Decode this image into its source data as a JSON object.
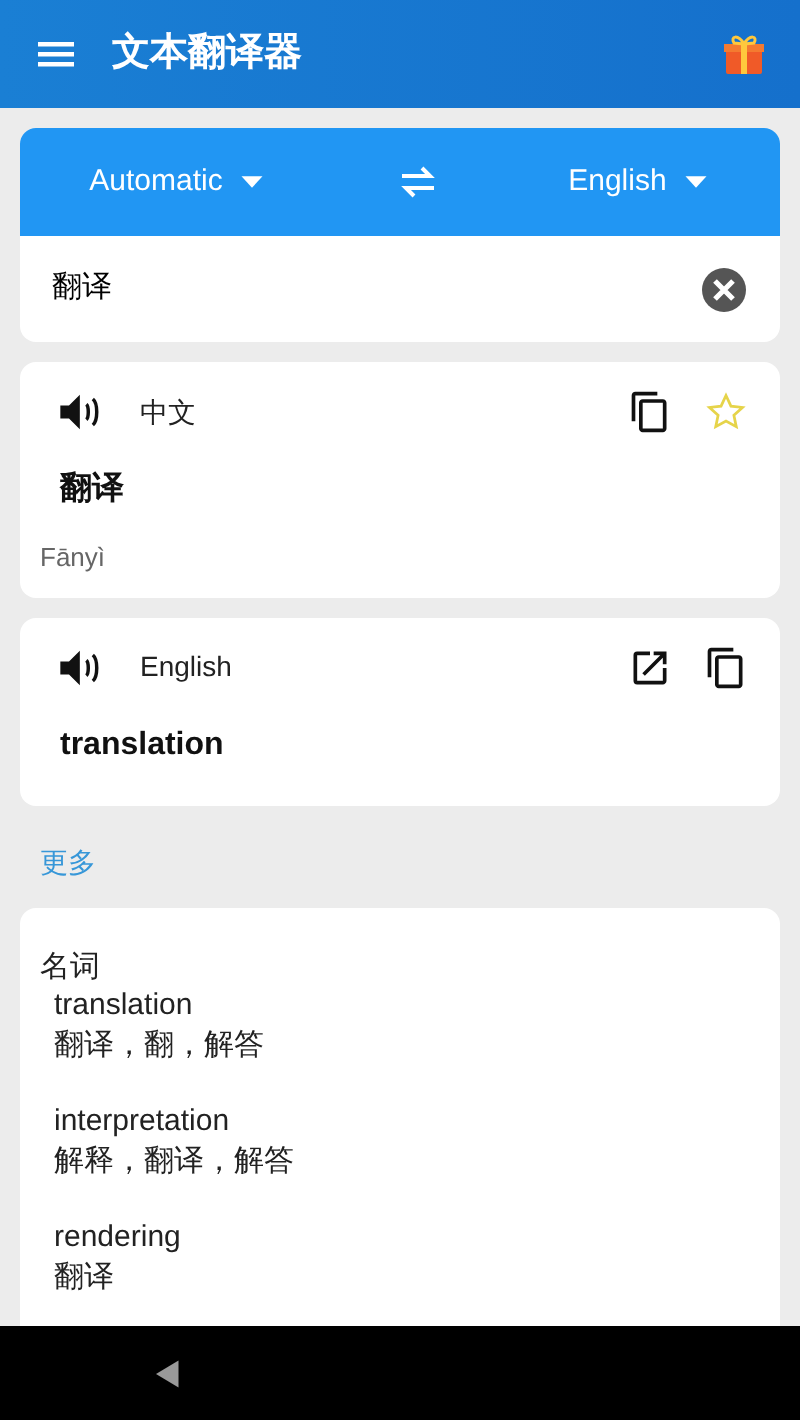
{
  "app_bar": {
    "title": "文本翻译器"
  },
  "languages": {
    "source": "Automatic",
    "target": "English"
  },
  "input": {
    "value": "翻译"
  },
  "results": [
    {
      "language": "中文",
      "text": "翻译",
      "romanization": "Fānyì",
      "actions": [
        {
          "kind": "copy"
        },
        {
          "kind": "star"
        }
      ],
      "starred": false
    },
    {
      "language": "English",
      "text": "translation",
      "actions": [
        {
          "kind": "open"
        },
        {
          "kind": "copy"
        }
      ]
    }
  ],
  "more_label": "更多",
  "dictionary": {
    "part_of_speech": "名词",
    "entries": [
      {
        "word": "translation",
        "meanings": "翻译，翻，解答"
      },
      {
        "word": "interpretation",
        "meanings": "解释，翻译，解答"
      },
      {
        "word": "rendering",
        "meanings": "翻译"
      }
    ]
  }
}
